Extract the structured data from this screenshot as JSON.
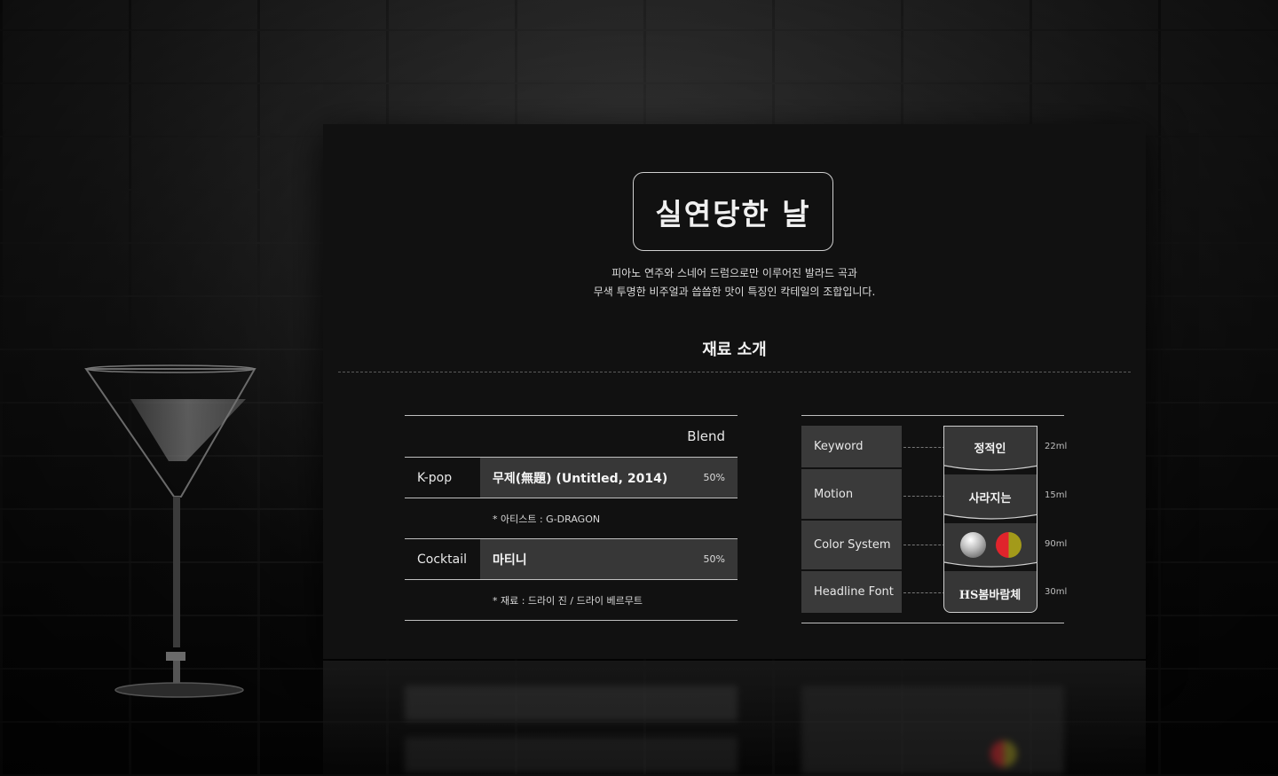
{
  "title": "실연당한 날",
  "description": [
    "피아노 연주와 스네어 드럼으로만 이루어진 발라드 곡과",
    "무색 투명한 비주얼과 씁씁한 맛이 특징인 칵테일의 조합입니다."
  ],
  "section_title": "재료 소개",
  "blend_table": {
    "header": "Blend",
    "rows": [
      {
        "category": "K-pop",
        "value": "무제(無題) (Untitled, 2014)",
        "percent": "50%",
        "note": "* 아티스트 : G-DRAGON"
      },
      {
        "category": "Cocktail",
        "value": "마티니",
        "percent": "50%",
        "note": "* 재료 : 드라이 진 / 드라이 베르무트"
      }
    ]
  },
  "recipe": {
    "rows": [
      {
        "label": "Keyword",
        "value": "정적인",
        "ml": "22ml"
      },
      {
        "label": "Motion",
        "value": "사라지는",
        "ml": "15ml"
      },
      {
        "label": "Color System",
        "value": "",
        "ml": "90ml"
      },
      {
        "label": "Headline Font",
        "value": "HS봄바람체",
        "ml": "30ml"
      }
    ],
    "colors": {
      "silver": "#d8d8d8",
      "red": "#e0242c",
      "olive": "#a39a1a"
    }
  }
}
